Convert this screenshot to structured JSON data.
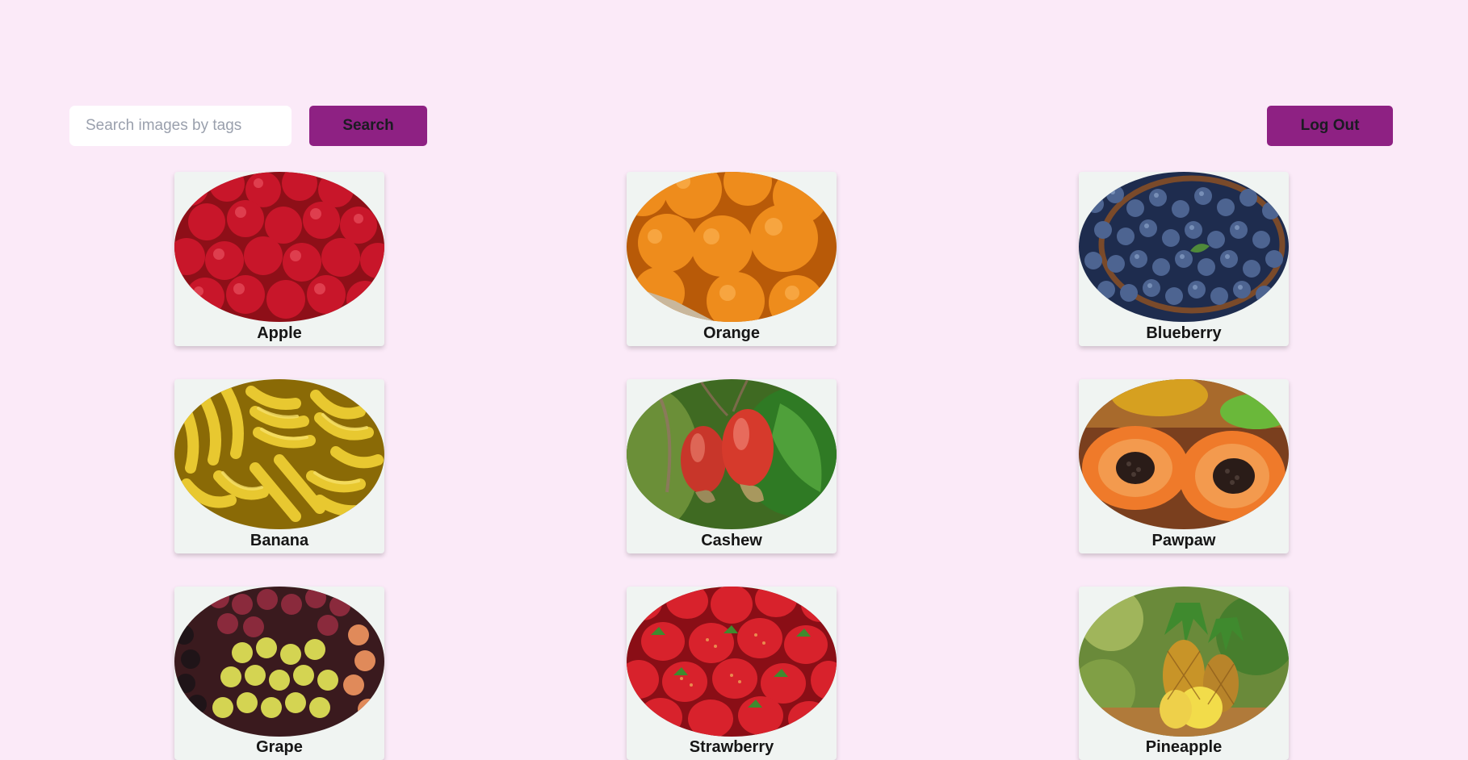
{
  "search": {
    "placeholder": "Search images by tags",
    "button_label": "Search"
  },
  "account": {
    "logout_label": "Log Out"
  },
  "colors": {
    "background": "#fbeaf8",
    "button": "#8e2183",
    "card": "#f0f4f2"
  },
  "gallery": [
    {
      "label": "Apple",
      "image": "apples-photo"
    },
    {
      "label": "Orange",
      "image": "oranges-photo"
    },
    {
      "label": "Blueberry",
      "image": "blueberries-photo"
    },
    {
      "label": "Banana",
      "image": "bananas-photo"
    },
    {
      "label": "Cashew",
      "image": "cashew-fruit-photo"
    },
    {
      "label": "Pawpaw",
      "image": "papaya-photo"
    },
    {
      "label": "Grape",
      "image": "grapes-photo"
    },
    {
      "label": "Strawberry",
      "image": "strawberries-photo"
    },
    {
      "label": "Pineapple",
      "image": "pineapple-photo"
    }
  ]
}
